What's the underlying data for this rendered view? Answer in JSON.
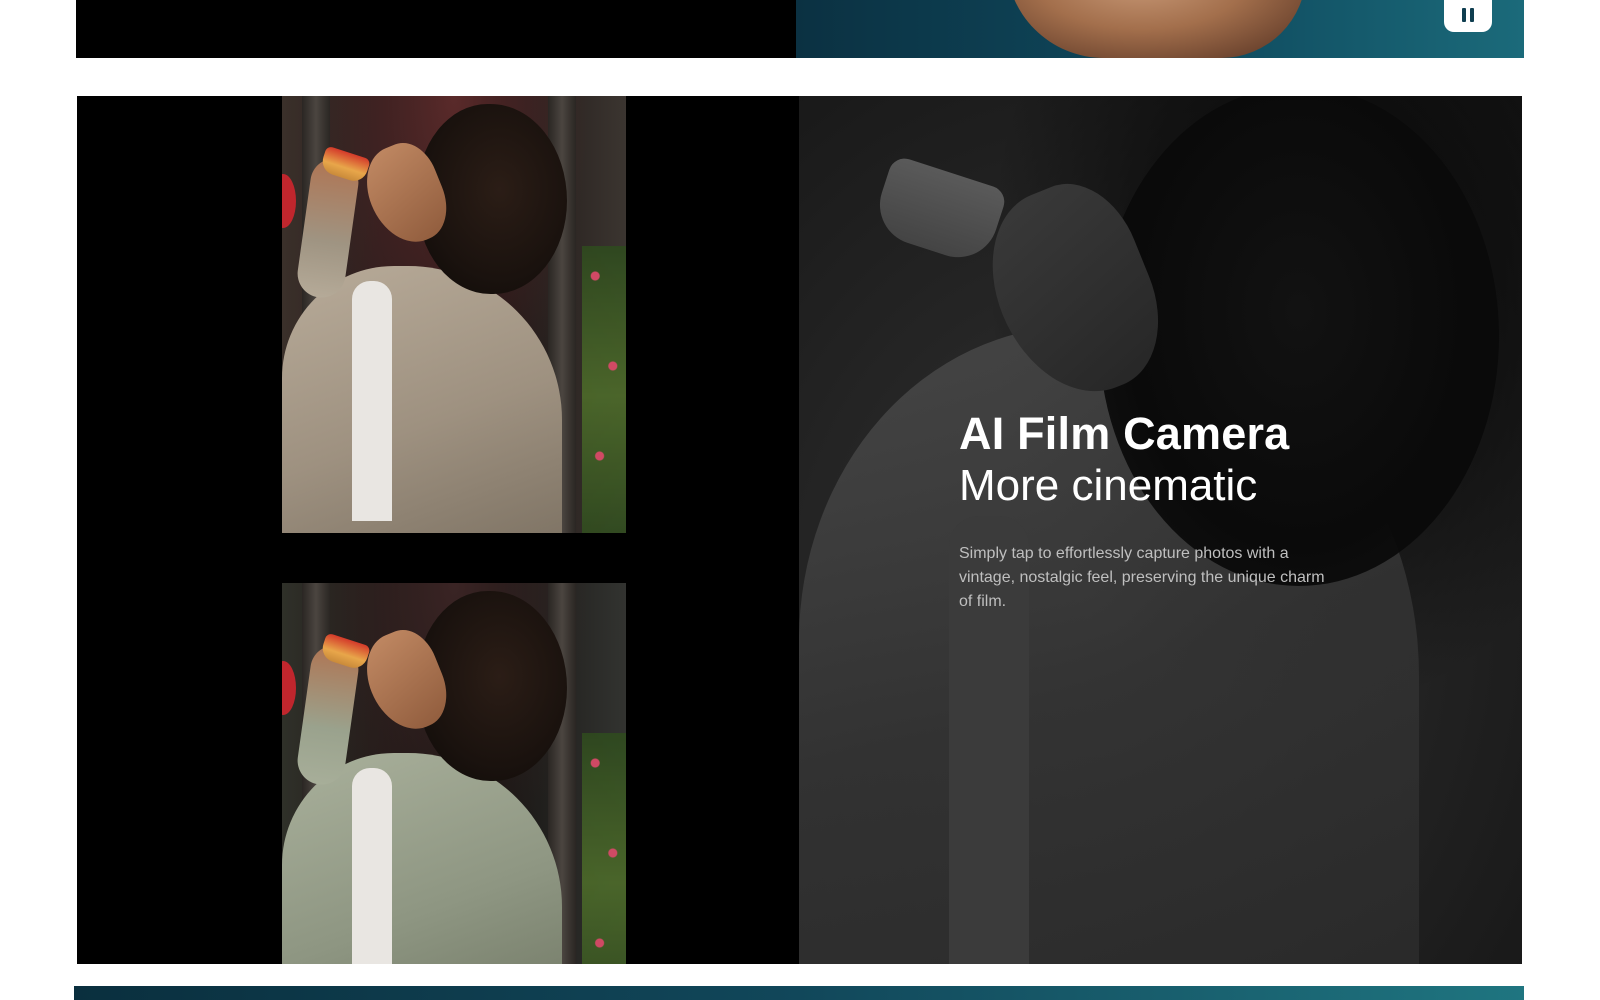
{
  "top_banner": {
    "pause_button_icon": "pause-icon"
  },
  "comparison": {
    "photos": [
      {
        "name": "photo-original",
        "tone": "warm"
      },
      {
        "name": "photo-film-filter",
        "tone": "green"
      }
    ]
  },
  "feature": {
    "title": "AI Film Camera",
    "subtitle": "More cinematic",
    "description": "Simply tap to effortlessly capture photos with a vintage, nostalgic feel, preserving the unique charm of film."
  },
  "colors": {
    "banner_teal": "#0f4a5e",
    "panel_dark": "#1e1e1e",
    "text_white": "#ffffff",
    "text_muted": "#bfbfbf"
  }
}
